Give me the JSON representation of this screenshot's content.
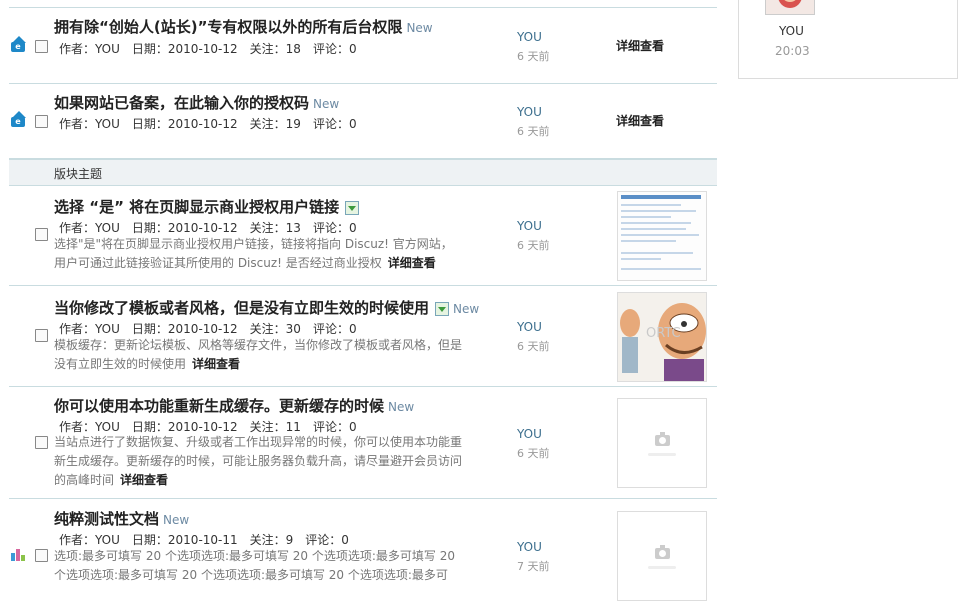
{
  "colors": {
    "accent": "#1e88c8",
    "border": "#c9dce0",
    "new_tag": "#6d8aa3"
  },
  "sidebar": {
    "user": "YOU",
    "time": "20:03"
  },
  "section_label": "版块主题",
  "labels": {
    "detail": "详细查看",
    "new": "New"
  },
  "threads": [
    {
      "title": "拥有除“创始人(站长)”专有权限以外的所有后台权限",
      "author_meta": "作者：YOU",
      "date": "日期：2010-10-12",
      "views": "关注：18",
      "replies": "评论：0",
      "last": "YOU",
      "ago": "6 天前",
      "icon": "sticky-up-icon"
    },
    {
      "title": "如果网站已备案，在此输入你的授权码",
      "author_meta": "作者：YOU",
      "date": "日期：2010-10-12",
      "views": "关注：19",
      "replies": "评论：0",
      "last": "YOU",
      "ago": "6 天前",
      "icon": "sticky-up-icon"
    },
    {
      "title": "选择 “是” 将在页脚显示商业授权用户链接",
      "author_meta": "作者：YOU",
      "date": "日期：2010-10-12",
      "views": "关注：13",
      "replies": "评论：0",
      "summary": "选择\"是\"将在页脚显示商业授权用户链接，链接将指向 Discuz! 官方网站，用户可通过此链接验证其所使用的 Discuz! 是否经过商业授权",
      "last": "YOU",
      "ago": "6 天前"
    },
    {
      "title": "当你修改了模板或者风格，但是没有立即生效的时候使用",
      "author_meta": "作者：YOU",
      "date": "日期：2010-10-12",
      "views": "关注：30",
      "replies": "评论：0",
      "summary": "模板缓存：更新论坛模板、风格等缓存文件，当你修改了模板或者风格，但是没有立即生效的时候使用",
      "last": "YOU",
      "ago": "6 天前"
    },
    {
      "title": "你可以使用本功能重新生成缓存。更新缓存的时候",
      "author_meta": "作者：YOU",
      "date": "日期：2010-10-12",
      "views": "关注：11",
      "replies": "评论：0",
      "summary": "当站点进行了数据恢复、升级或者工作出现异常的时候，你可以使用本功能重新生成缓存。更新缓存的时候，可能让服务器负载升高，请尽量避开会员访问的高峰时间",
      "last": "YOU",
      "ago": "6 天前"
    },
    {
      "title": "纯粹测试性文档",
      "author_meta": "作者：YOU",
      "date": "日期：2010-10-11",
      "views": "关注：9",
      "replies": "评论：0",
      "summary": "选项:最多可填写 20 个选项选项:最多可填写 20 个选项选项:最多可填写 20 个选项选项:最多可填写 20 个选项选项:最多可填写 20 个选项选项:最多可",
      "last": "YOU",
      "ago": "7 天前",
      "icon": "poll-icon"
    }
  ]
}
